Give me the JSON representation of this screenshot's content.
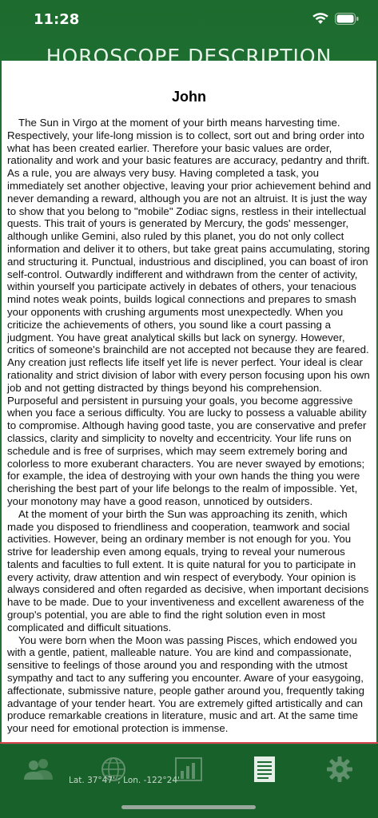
{
  "status": {
    "time": "11:28"
  },
  "header": {
    "title": "HOROSCOPE DESCRIPTION"
  },
  "card": {
    "title": "John",
    "paragraphs": [
      "The Sun in Virgo at the moment of your birth means harvesting time. Respectively, your life-long mission is to collect, sort out and bring order into what has been created earlier. Therefore your basic values are order, rationality and work and your basic features are accuracy, pedantry and thrift. As a rule, you are always very busy. Having completed a task, you immediately set another objective, leaving your prior achievement behind and never demanding a reward, although you are not an altruist. It is just the way to show that you belong to \"mobile\" Zodiac signs, restless in their intellectual quests. This trait of yours is generated by Mercury, the gods' messenger, although unlike Gemini, also ruled by this planet, you do not only collect information and deliver it to others, but take great pains accumulating, storing and structuring it. Punctual, industrious and disciplined, you can boast of iron self-control. Outwardly indifferent and withdrawn from the center of activity, within yourself you participate actively in debates of others, your tenacious mind notes weak points, builds logical connections and prepares to smash your opponents with crushing arguments most unexpectedly. When you criticize the achievements of others, you sound like a court passing a judgment. You have great analytical skills but lack on synergy. However, critics of someone's brainchild are not accepted not because they are feared. Any creation just reflects life itself yet life is never perfect. Your ideal is clear rationality and strict division of labor with every person focusing upon his own job and not getting distracted by things beyond his comprehension. Purposeful and persistent in pursuing your goals, you become aggressive when you face a serious difficulty. You are lucky to possess a valuable ability to compromise. Although having good taste, you are conservative and prefer classics, clarity and simplicity to novelty and eccentricity. Your life runs on schedule and is free of surprises, which may seem extremely boring and colorless to more exuberant characters. You are never swayed by emotions; for example, the idea of destroying with your own hands the thing you were cherishing the best part of your life belongs to the realm of impossible. Yet, your monotony may have a good reason, unnoticed by outsiders.",
      "At the moment of your birth the Sun was approaching its zenith, which made you disposed to friendliness and cooperation, teamwork and social activities. However, being an ordinary member is not enough for you. You strive for leadership even among equals, trying to reveal your numerous talents and faculties to full extent. It is quite natural for you to participate in every activity, draw attention and win respect of everybody. Your opinion is always considered and often regarded as decisive, when important decisions have to be made. Due to your inventiveness and excellent awareness of the group's potential, you are able to find the right solution even in most complicated and difficult situations.",
      "You were born when the Moon was passing Pisces, which endowed you with a gentle, patient, malleable nature. You are kind and compassionate, sensitive to feelings of those around you and responding with the utmost sympathy and tact to any suffering you encounter. Aware of your easygoing, affectionate, submissive nature, people gather around you, frequently taking advantage of your tender heart. You are extremely gifted artistically and can produce remarkable creations in literature, music and art. At the same time your need for emotional protection is immense."
    ]
  },
  "tabbar": {
    "coords": "Lat. 37°47' ; Lon. -122°24'",
    "tabs": [
      {
        "icon": "people-icon"
      },
      {
        "icon": "globe-icon"
      },
      {
        "icon": "chart-icon"
      },
      {
        "icon": "document-icon",
        "active": true
      },
      {
        "icon": "gear-icon"
      }
    ]
  }
}
